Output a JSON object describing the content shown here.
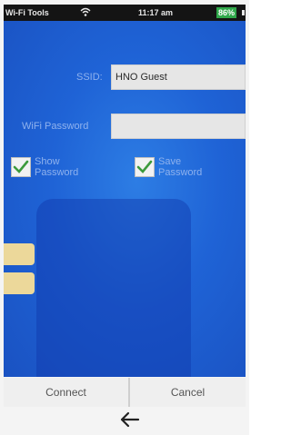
{
  "status_bar": {
    "app_name": "Wi-Fi Tools",
    "icon": "wifi-icon",
    "time": "11:17 am",
    "battery": "86%"
  },
  "form": {
    "ssid_label": "SSID:",
    "ssid_value": "HNO Guest",
    "password_label": "WiFi Password",
    "password_value": "",
    "show_password_label": "Show Password",
    "show_password_checked": true,
    "save_password_label": "Save Password",
    "save_password_checked": true
  },
  "buttons": {
    "connect": "Connect",
    "cancel": "Cancel"
  },
  "navigation": {
    "back_icon": "back-arrow-icon"
  },
  "colors": {
    "panel": "#1f63d6",
    "battery": "#2fa84a",
    "label": "#8fb2ee"
  }
}
